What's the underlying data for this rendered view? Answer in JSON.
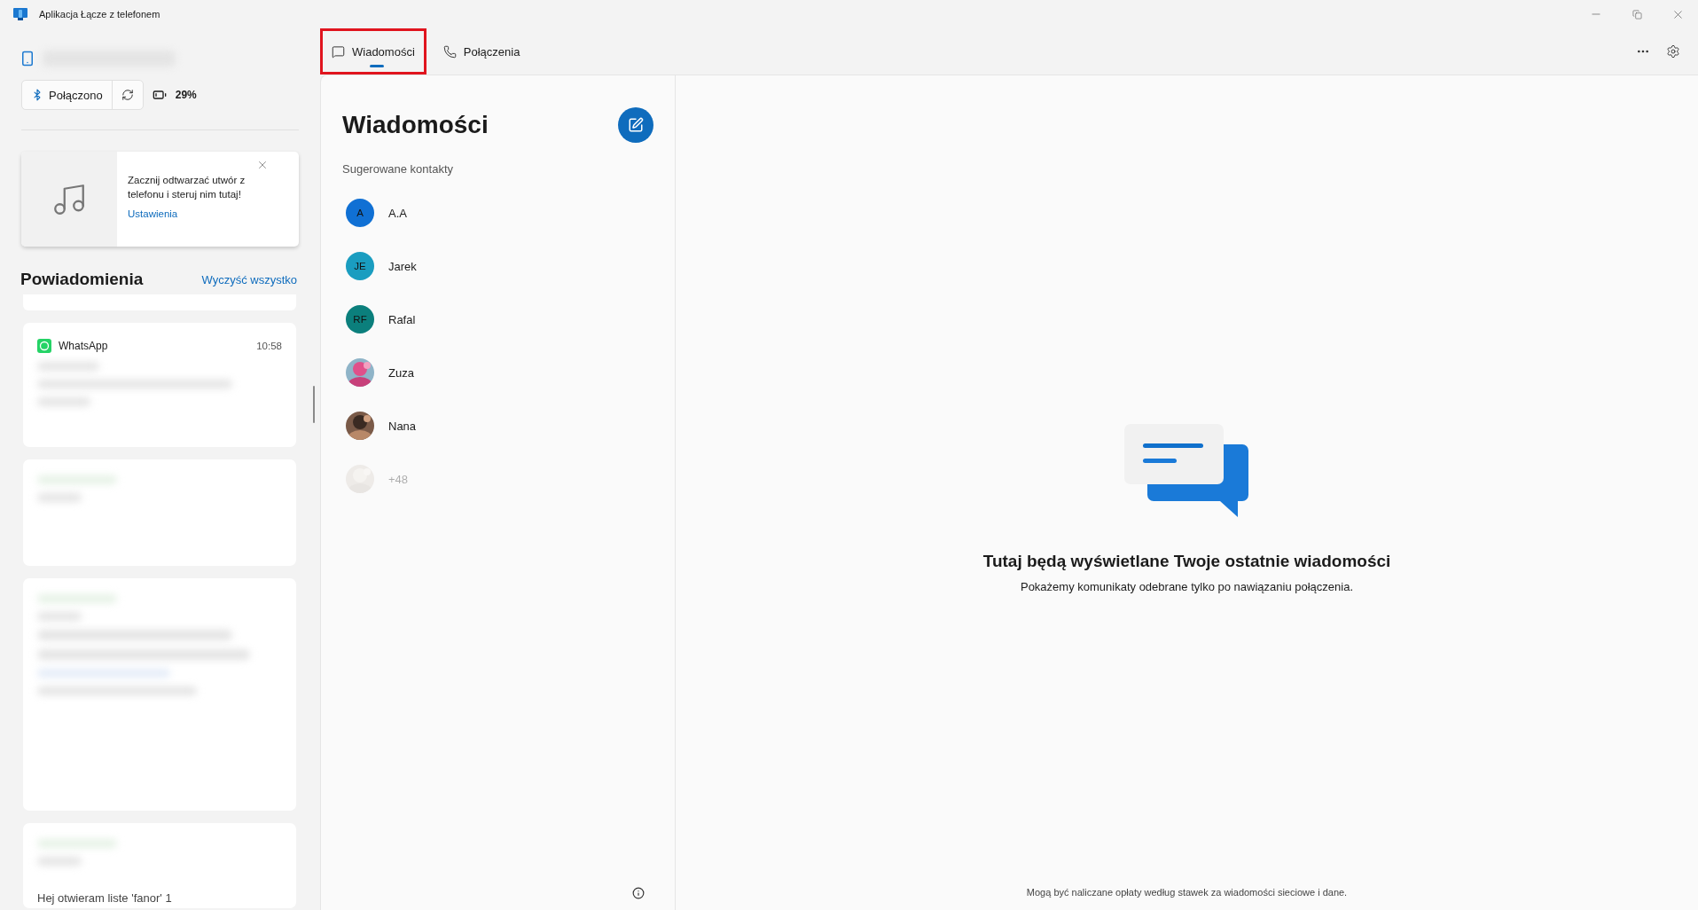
{
  "window": {
    "title": "Aplikacja Łącze z telefonem"
  },
  "device": {
    "status": "Połączono",
    "battery": "29%"
  },
  "media_card": {
    "message": "Zacznij odtwarzać utwór z telefonu i steruj nim tutaj!",
    "link": "Ustawienia"
  },
  "notifications": {
    "title": "Powiadomienia",
    "clear_all": "Wyczyść wszystko",
    "items": [
      {
        "kind": "app",
        "app": "WhatsApp",
        "time": "10:58"
      },
      {
        "kind": "blurred"
      },
      {
        "kind": "blurred"
      },
      {
        "kind": "blurred",
        "text": "Hej otwieram liste 'fanor' 1"
      }
    ]
  },
  "tabs": [
    {
      "label": "Wiadomości",
      "selected": true,
      "highlighted": true
    },
    {
      "label": "Połączenia",
      "selected": false,
      "highlighted": false
    }
  ],
  "messages": {
    "title": "Wiadomości",
    "suggested_label": "Sugerowane kontakty",
    "contacts": [
      {
        "name": "A.A",
        "kind": "initials",
        "initials": "A",
        "color": "#1070d4",
        "disabled": false
      },
      {
        "name": "Jarek",
        "kind": "initials",
        "initials": "JE",
        "color": "#1a9dc0",
        "disabled": false
      },
      {
        "name": "Rafal",
        "kind": "initials",
        "initials": "RF",
        "color": "#0b7f7c",
        "disabled": false
      },
      {
        "name": "Zuza",
        "disabled": false
      },
      {
        "name": "Nana",
        "disabled": false
      },
      {
        "name": "+48",
        "disabled": true
      }
    ]
  },
  "empty_state": {
    "title": "Tutaj będą wyświetlane Twoje ostatnie wiadomości",
    "subtitle": "Pokażemy komunikaty odebrane tylko po nawiązaniu połączenia."
  },
  "footer": {
    "note": "Mogą być naliczane opłaty według stawek za wiadomości sieciowe i dane."
  }
}
